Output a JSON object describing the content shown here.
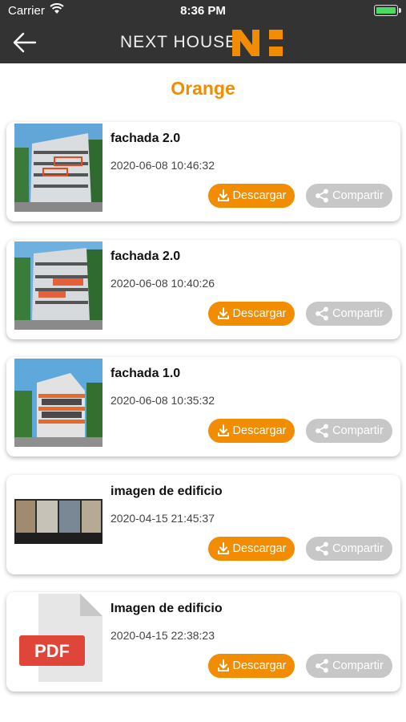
{
  "status_bar": {
    "carrier": "Carrier",
    "time": "8:36 PM"
  },
  "header": {
    "brand": "NEXT HOUSE",
    "logo_text": "N:"
  },
  "page": {
    "title": "Orange"
  },
  "colors": {
    "accent": "#f28c00",
    "header_bg": "#333333",
    "share_bg": "#c7c7c7"
  },
  "items": [
    {
      "name": "fachada 2.0",
      "date": "2020-06-08 10:46:32",
      "download_label": "Descargar",
      "share_label": "Compartir",
      "thumb": "building-render"
    },
    {
      "name": "fachada 2.0",
      "date": "2020-06-08 10:40:26",
      "download_label": "Descargar",
      "share_label": "Compartir",
      "thumb": "building-render"
    },
    {
      "name": "fachada 1.0",
      "date": "2020-06-08 10:35:32",
      "download_label": "Descargar",
      "share_label": "Compartir",
      "thumb": "building-render"
    },
    {
      "name": "imagen de edificio",
      "date": "2020-04-15 21:45:37",
      "download_label": "Descargar",
      "share_label": "Compartir",
      "thumb": "street-photos"
    },
    {
      "name": "Imagen de edificio",
      "date": "2020-04-15 22:38:23",
      "download_label": "Descargar",
      "share_label": "Compartir",
      "thumb": "pdf-file-icon",
      "file_badge": "PDF"
    }
  ]
}
